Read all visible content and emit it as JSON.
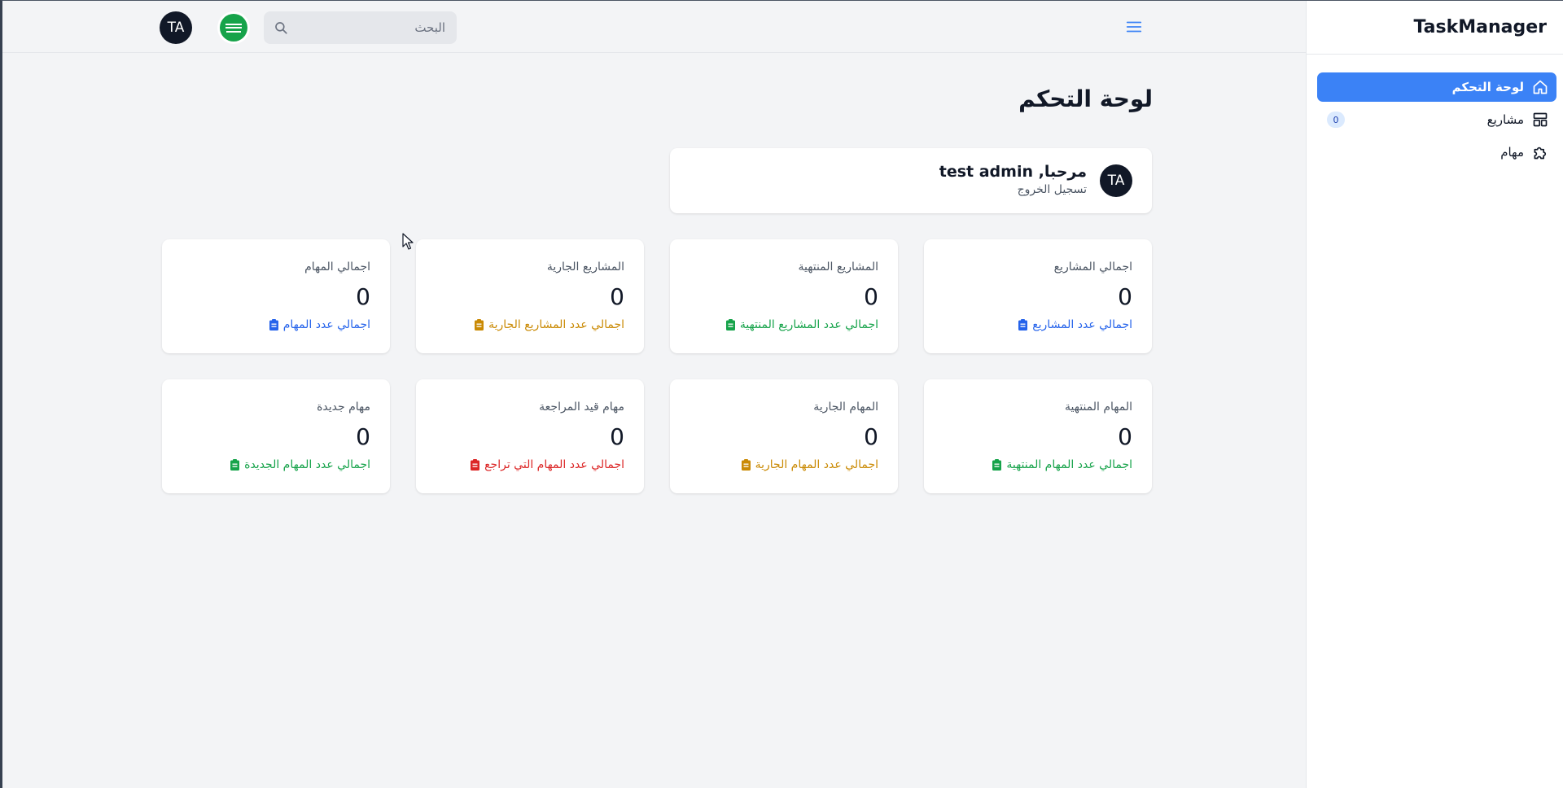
{
  "sidebar": {
    "brand": "TaskManager",
    "items": [
      {
        "label": "لوحة التحكم",
        "icon": "home-icon",
        "active": true
      },
      {
        "label": "مشاريع",
        "icon": "layout-icon",
        "badge": "0"
      },
      {
        "label": "مهام",
        "icon": "puzzle-icon"
      }
    ]
  },
  "header": {
    "search_placeholder": "البحث",
    "avatar_initials": "TA",
    "flag_icon": "saudi-flag-icon",
    "menu_icon": "hamburger-icon"
  },
  "main": {
    "title": "لوحة التحكم",
    "welcome": {
      "title": "مرحبا, test admin",
      "logout": "تسجيل الخروج",
      "avatar": "TA"
    },
    "stats": [
      {
        "label": "اجمالي المشاريع",
        "value": "0",
        "link": "اجمالي عدد المشاريع",
        "color": "#2563eb"
      },
      {
        "label": "المشاريع المنتهية",
        "value": "0",
        "link": "اجمالي عدد المشاريع المنتهية",
        "color": "#16a34a"
      },
      {
        "label": "المشاريع الجارية",
        "value": "0",
        "link": "اجمالي عدد المشاريع الجارية",
        "color": "#ca8a04"
      },
      {
        "label": "اجمالي المهام",
        "value": "0",
        "link": "اجمالي عدد المهام",
        "color": "#2563eb"
      },
      {
        "label": "المهام المنتهية",
        "value": "0",
        "link": "اجمالي عدد المهام المنتهية",
        "color": "#16a34a"
      },
      {
        "label": "المهام الجارية",
        "value": "0",
        "link": "اجمالي عدد المهام الجارية",
        "color": "#ca8a04"
      },
      {
        "label": "مهام قيد المراجعة",
        "value": "0",
        "link": "اجمالي عدد المهام التي تراجع",
        "color": "#dc2626"
      },
      {
        "label": "مهام جديدة",
        "value": "0",
        "link": "اجمالي عدد المهام الجديدة",
        "color": "#16a34a"
      }
    ]
  },
  "colors": {
    "accent": "#3b82f6",
    "background": "#f3f4f6",
    "avatar_bg": "#111827"
  }
}
